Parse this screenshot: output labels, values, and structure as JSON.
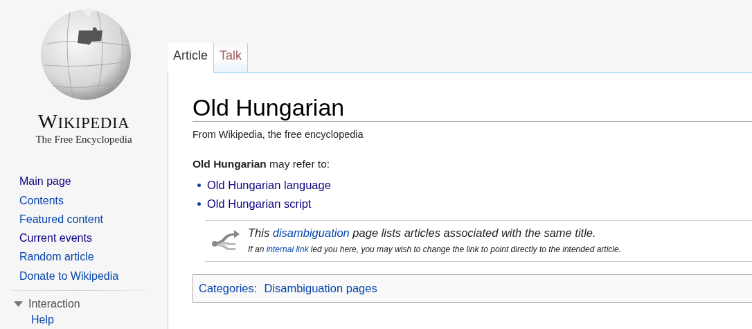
{
  "logo": {
    "wordmark": "WIKIPEDIA",
    "tagline": "The Free Encyclopedia"
  },
  "navigation": [
    {
      "label": "Main page",
      "visited": true
    },
    {
      "label": "Contents",
      "visited": false
    },
    {
      "label": "Featured content",
      "visited": false
    },
    {
      "label": "Current events",
      "visited": true
    },
    {
      "label": "Random article",
      "visited": false
    },
    {
      "label": "Donate to Wikipedia",
      "visited": false
    }
  ],
  "portal": {
    "heading": "Interaction",
    "expanded": true,
    "items": [
      "Help"
    ]
  },
  "tabs": [
    {
      "label": "Article",
      "selected": true
    },
    {
      "label": "Talk",
      "selected": false
    }
  ],
  "article": {
    "title": "Old Hungarian",
    "subtitle": "From Wikipedia, the free encyclopedia",
    "intro": "**Old Hungarian** may refer to:",
    "links": [
      "Old Hungarian language",
      "Old Hungarian script"
    ],
    "notice": {
      "line_1": {
        "before": "This ",
        "link": "disambiguation",
        "after": " page lists articles associated with the same title."
      },
      "line_2": {
        "before": "If an ",
        "link": "internal link",
        "after": " led you here, you may wish to change the link to point directly to the intended article."
      }
    },
    "categories": {
      "label": "Categories:",
      "items": [
        "Disambiguation pages"
      ]
    }
  }
}
